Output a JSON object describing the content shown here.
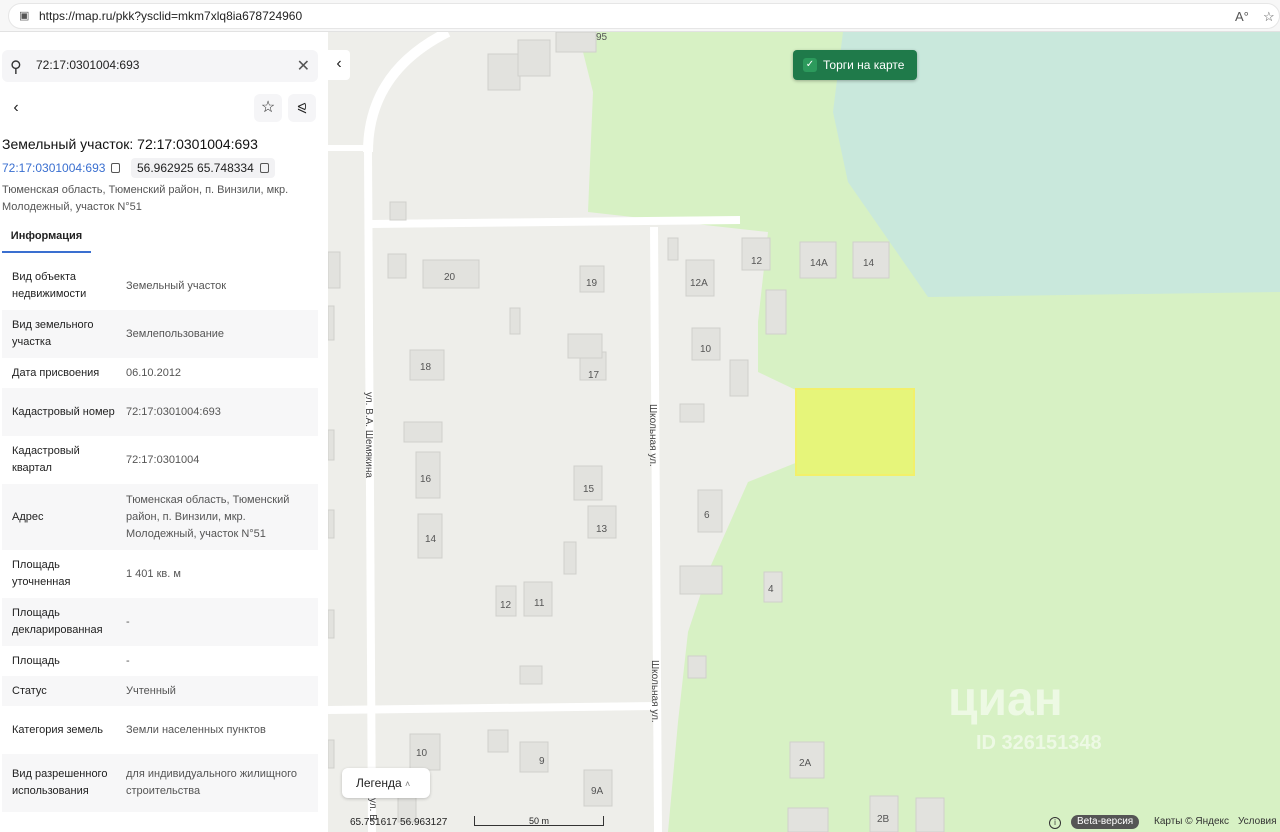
{
  "browser": {
    "url": "https://map.ru/pkk?ysclid=mkm7xlq8ia678724960",
    "reader_icon": "A°",
    "star_icon": "☆"
  },
  "search": {
    "value": "72:17:0301004:693"
  },
  "parcel": {
    "title": "Земельный участок: 72:17:0301004:693",
    "cadastral_link": "72:17:0301004:693",
    "coordinates": "56.962925 65.748334",
    "address": "Тюменская область, Тюменский район, п. Винзили, мкр. Молодежный, участок N°51",
    "tab": "Информация"
  },
  "info_rows": [
    {
      "key": "Вид объекта недвижимости",
      "value": "Земельный участок"
    },
    {
      "key": "Вид земельного участка",
      "value": "Землепользование"
    },
    {
      "key": "Дата присвоения",
      "value": "06.10.2012"
    },
    {
      "key": "Кадастровый номер",
      "value": "72:17:0301004:693"
    },
    {
      "key": "Кадастровый квартал",
      "value": "72:17:0301004"
    },
    {
      "key": "Адрес",
      "value": "Тюменская область, Тюменский район, п. Винзили, мкр. Молодежный, участок N°51"
    },
    {
      "key": "Площадь уточненная",
      "value": "1 401 кв. м"
    },
    {
      "key": "Площадь декларированная",
      "value": "-"
    },
    {
      "key": "Площадь",
      "value": "-"
    },
    {
      "key": "Статус",
      "value": "Учтенный"
    },
    {
      "key": "Категория земель",
      "value": "Земли населенных пунктов"
    },
    {
      "key": "Вид разрешенного использования",
      "value": "для индивидуального жилищного строительства"
    }
  ],
  "map": {
    "torgi_label": "Торги на карте",
    "legend_label": "Легенда",
    "coords": "65.751617  56.963127",
    "scale_label": "50 m",
    "beta_label": "Beta-версия",
    "attribution": "Карты © Яндекс",
    "terms": "Условия",
    "watermark": "циан",
    "watermark_id": "ID 326151348",
    "street_1": "ул. В.А. Шемякина",
    "street_2": "Школьная ул.",
    "street_3": "Школьная ул.",
    "street_4": "ул. В",
    "house_numbers": [
      "95",
      "20",
      "19",
      "12",
      "14А",
      "14",
      "12А",
      "18",
      "17",
      "10",
      "16",
      "15",
      "13",
      "6",
      "14",
      "12",
      "11",
      "4",
      "10",
      "9",
      "9А",
      "2А",
      "2В"
    ],
    "colors": {
      "forest": "#d7f1c4",
      "water": "#c9e8dc",
      "parcel": "#e6f57a",
      "building": "#e2e2de",
      "road": "#ffffff"
    }
  }
}
